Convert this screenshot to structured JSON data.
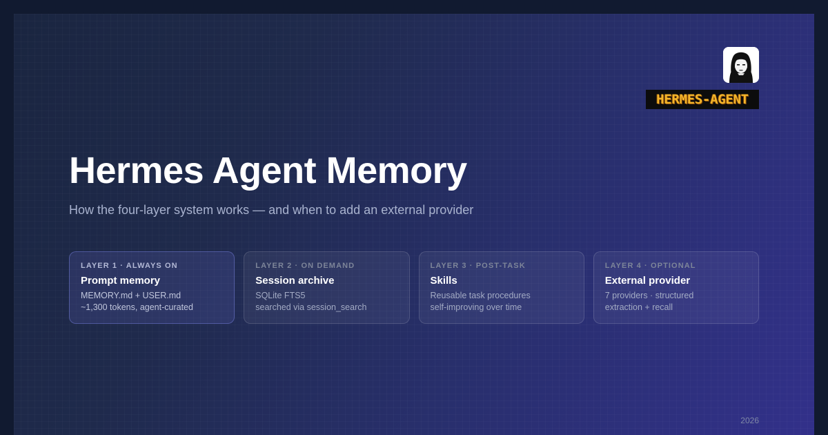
{
  "brand": {
    "logo_text": "HERMES-AGENT",
    "wordmark_color": "#f4b52a"
  },
  "hero": {
    "title": "Hermes Agent Memory",
    "subtitle": "How the four-layer system works — and when to add an external provider"
  },
  "layers": [
    {
      "label": "LAYER 1 · ALWAYS ON",
      "title": "Prompt memory",
      "line1": "MEMORY.md + USER.md",
      "line2": "~1,300 tokens, agent-curated",
      "highlighted": true
    },
    {
      "label": "LAYER 2 · ON DEMAND",
      "title": "Session archive",
      "line1": "SQLite FTS5",
      "line2": "searched via session_search",
      "highlighted": false
    },
    {
      "label": "LAYER 3 · POST-TASK",
      "title": "Skills",
      "line1": "Reusable task procedures",
      "line2": "self-improving over time",
      "highlighted": false
    },
    {
      "label": "LAYER 4 · OPTIONAL",
      "title": "External provider",
      "line1": "7 providers · structured",
      "line2": "extraction + recall",
      "highlighted": false
    }
  ],
  "footer": {
    "year": "2026"
  }
}
